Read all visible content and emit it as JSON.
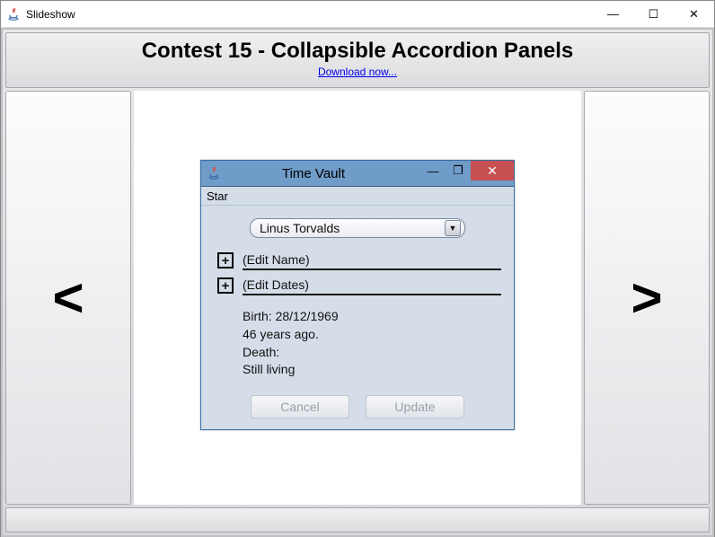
{
  "window": {
    "title": "Slideshow",
    "min_icon": "—",
    "max_icon": "☐",
    "close_icon": "✕"
  },
  "header": {
    "title": "Contest 15 - Collapsible Accordion Panels",
    "download_link": "Download now..."
  },
  "nav": {
    "prev": "<",
    "next": ">"
  },
  "slide": {
    "window_title": "Time Vault",
    "min_icon": "—",
    "max_icon": "❐",
    "close_icon": "✕",
    "menu": {
      "star": "Star"
    },
    "dropdown_value": "Linus Torvalds",
    "edit_name_label": "(Edit Name)",
    "edit_dates_label": "(Edit Dates)",
    "info": {
      "birth_label": "Birth: 28/12/1969",
      "age_line": "46 years ago.",
      "death_label": "Death:",
      "death_value": "Still living"
    },
    "buttons": {
      "cancel": "Cancel",
      "update": "Update"
    }
  }
}
